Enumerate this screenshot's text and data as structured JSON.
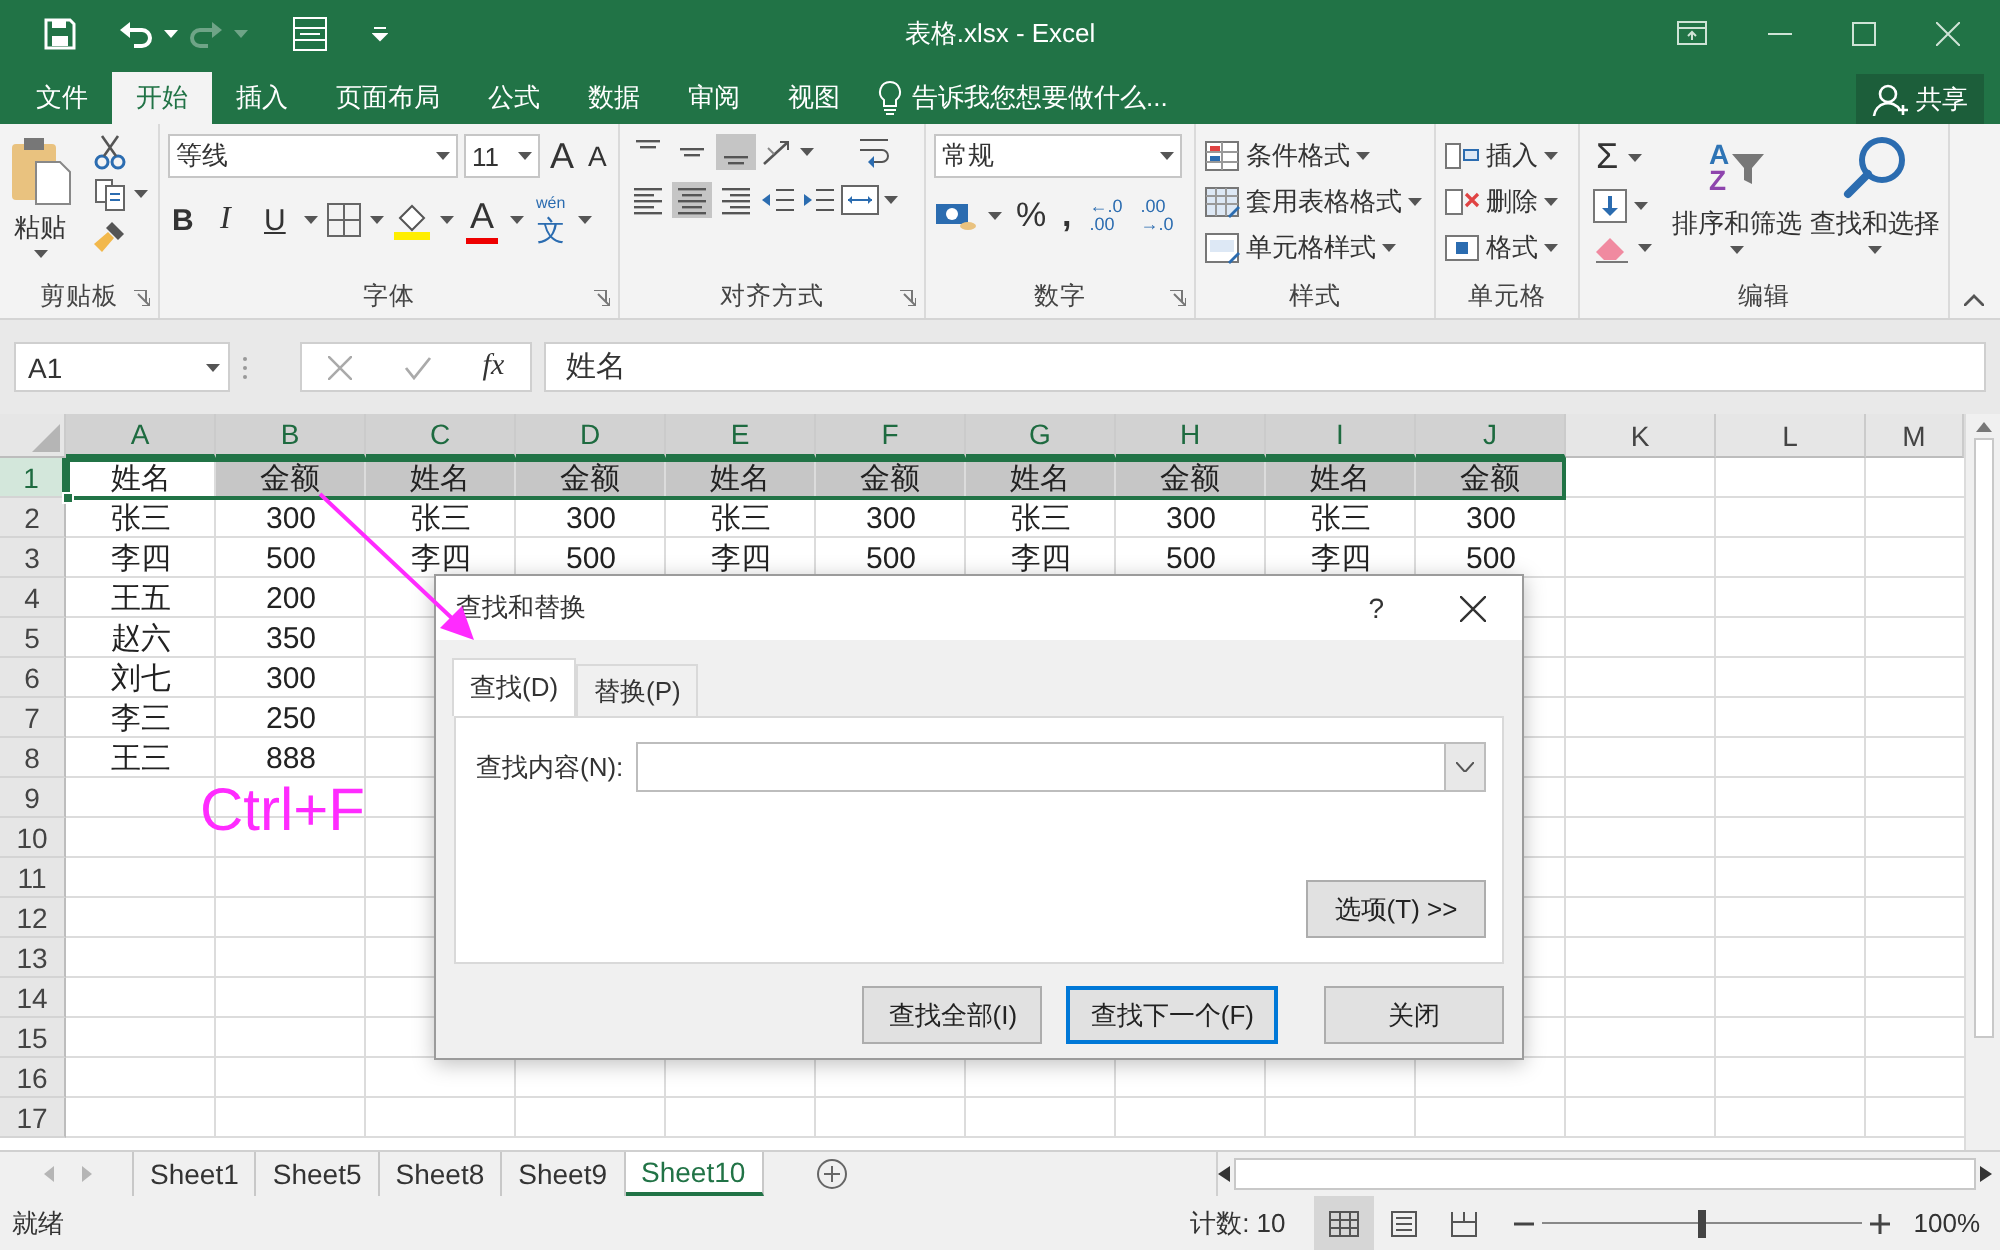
{
  "title_bar": {
    "title": "表格.xlsx - Excel"
  },
  "tabs": [
    {
      "label": "文件",
      "selected": false
    },
    {
      "label": "开始",
      "selected": true
    },
    {
      "label": "插入",
      "selected": false
    },
    {
      "label": "页面布局",
      "selected": false
    },
    {
      "label": "公式",
      "selected": false
    },
    {
      "label": "数据",
      "selected": false
    },
    {
      "label": "审阅",
      "selected": false
    },
    {
      "label": "视图",
      "selected": false
    }
  ],
  "tell_me": "告诉我您想要做什么...",
  "share": "共享",
  "ribbon": [
    {
      "kind": "clipboard",
      "label": "剪贴板",
      "paste": "粘贴"
    },
    {
      "kind": "font",
      "label": "字体",
      "font_name": "等线",
      "font_size": "11",
      "grow": "A",
      "shrink": "A",
      "bold": "B",
      "italic": "I",
      "underline": "U",
      "font_color": "A",
      "phonetic_top": "wén",
      "phonetic": "文"
    },
    {
      "kind": "alignment",
      "label": "对齐方式",
      "vertical": [
        {
          "kind": "top",
          "selected": false
        },
        {
          "kind": "middle",
          "selected": false
        },
        {
          "kind": "bottom",
          "selected": true
        }
      ],
      "horizontal": [
        {
          "kind": "left",
          "selected": false
        },
        {
          "kind": "center",
          "selected": true
        },
        {
          "kind": "right",
          "selected": false
        }
      ]
    },
    {
      "kind": "number",
      "label": "数字",
      "format": "常规",
      "percent": "%",
      "comma": ",",
      "decimals": [
        {
          "top": "←.0",
          "bottom": ".00"
        },
        {
          "top": ".00",
          "bottom": "→.0"
        }
      ]
    },
    {
      "kind": "styles",
      "label": "样式",
      "items": [
        "条件格式",
        "套用表格格式",
        "单元格样式"
      ]
    },
    {
      "kind": "cells",
      "label": "单元格",
      "items": [
        "插入",
        "删除",
        "格式"
      ]
    },
    {
      "kind": "editing",
      "label": "编辑",
      "sum": "Σ",
      "sort_letters": [
        "A",
        "Z"
      ],
      "sort": "排序和筛选",
      "find": "查找和选择"
    }
  ],
  "formula_bar": {
    "name_box": "A1",
    "fx": "fx",
    "formula": "姓名"
  },
  "sheet": {
    "columns": [
      {
        "label": "A",
        "selected": true
      },
      {
        "label": "B",
        "selected": true
      },
      {
        "label": "C",
        "selected": true
      },
      {
        "label": "D",
        "selected": true
      },
      {
        "label": "E",
        "selected": true
      },
      {
        "label": "F",
        "selected": true
      },
      {
        "label": "G",
        "selected": true
      },
      {
        "label": "H",
        "selected": true
      },
      {
        "label": "I",
        "selected": true
      },
      {
        "label": "J",
        "selected": true
      },
      {
        "label": "K",
        "selected": false
      },
      {
        "label": "L",
        "selected": false
      },
      {
        "label": "M",
        "selected": false
      }
    ],
    "rows": [
      {
        "header": "1",
        "selected": true,
        "cells": [
          "姓名",
          "金额",
          "姓名",
          "金额",
          "姓名",
          "金额",
          "姓名",
          "金额",
          "姓名",
          "金额"
        ]
      },
      {
        "header": "2",
        "selected": false,
        "cells": [
          "张三",
          "300",
          "张三",
          "300",
          "张三",
          "300",
          "张三",
          "300",
          "张三",
          "300"
        ]
      },
      {
        "header": "3",
        "selected": false,
        "cells": [
          "李四",
          "500",
          "李四",
          "500",
          "李四",
          "500",
          "李四",
          "500",
          "李四",
          "500"
        ]
      },
      {
        "header": "4",
        "selected": false,
        "cells": [
          "王五",
          "200"
        ]
      },
      {
        "header": "5",
        "selected": false,
        "cells": [
          "赵六",
          "350"
        ]
      },
      {
        "header": "6",
        "selected": false,
        "cells": [
          "刘七",
          "300"
        ]
      },
      {
        "header": "7",
        "selected": false,
        "cells": [
          "李三",
          "250"
        ]
      },
      {
        "header": "8",
        "selected": false,
        "cells": [
          "王三",
          "888"
        ]
      },
      {
        "header": "9",
        "selected": false,
        "cells": []
      },
      {
        "header": "10",
        "selected": false,
        "cells": []
      },
      {
        "header": "11",
        "selected": false,
        "cells": []
      },
      {
        "header": "12",
        "selected": false,
        "cells": []
      },
      {
        "header": "13",
        "selected": false,
        "cells": []
      },
      {
        "header": "14",
        "selected": false,
        "cells": []
      },
      {
        "header": "15",
        "selected": false,
        "cells": []
      },
      {
        "header": "16",
        "selected": false,
        "cells": []
      },
      {
        "header": "17",
        "selected": false,
        "cells": []
      }
    ]
  },
  "sheet_tabs": [
    {
      "label": "Sheet1",
      "selected": false
    },
    {
      "label": "Sheet5",
      "selected": false
    },
    {
      "label": "Sheet8",
      "selected": false
    },
    {
      "label": "Sheet9",
      "selected": false
    },
    {
      "label": "Sheet10",
      "selected": true
    }
  ],
  "status_bar": {
    "status": "就绪",
    "count": "计数: 10",
    "views": [
      {
        "kind": "normal",
        "selected": true
      },
      {
        "kind": "page_layout",
        "selected": false
      },
      {
        "kind": "page_break",
        "selected": false
      }
    ],
    "zoom_slider": {
      "level": 0.5
    },
    "zoom": "100%"
  },
  "dialog": {
    "title": "查找和替换",
    "help": "?",
    "tabs": [
      {
        "label": "查找(D)",
        "selected": true
      },
      {
        "label": "替换(P)",
        "selected": false
      }
    ],
    "find_label": "查找内容(N):",
    "options": "选项(T) >>",
    "buttons": [
      {
        "label": "查找全部(I)",
        "default": false
      },
      {
        "label": "查找下一个(F)",
        "default": true
      },
      {
        "label": "关闭",
        "default": false
      }
    ]
  },
  "annotation": {
    "text": "Ctrl+F"
  }
}
